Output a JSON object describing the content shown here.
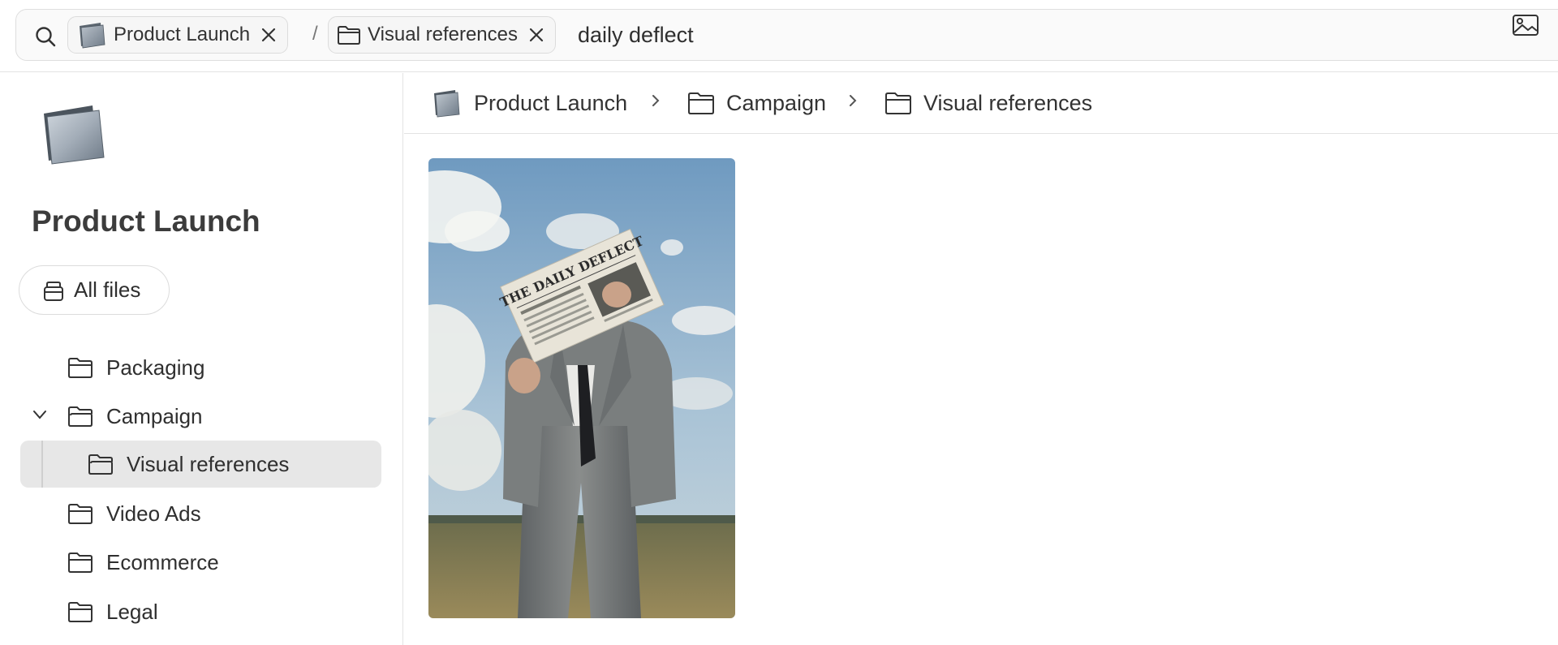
{
  "search": {
    "chips": [
      {
        "label": "Product Launch",
        "icon": "stack-folder-icon"
      },
      {
        "label": "Visual references",
        "icon": "folder-icon"
      }
    ],
    "separator": "/",
    "query": "daily deflect"
  },
  "sidebar": {
    "title": "Product Launch",
    "all_files_label": "All files",
    "items": [
      {
        "label": "Packaging",
        "icon": "folder-icon"
      },
      {
        "label": "Campaign",
        "icon": "folder-open-icon",
        "expanded": true
      },
      {
        "label": "Visual references",
        "icon": "folder-open-icon",
        "selected": true
      },
      {
        "label": "Video Ads",
        "icon": "folder-icon"
      },
      {
        "label": "Ecommerce",
        "icon": "folder-icon"
      },
      {
        "label": "Legal",
        "icon": "folder-icon"
      }
    ]
  },
  "breadcrumb": [
    {
      "label": "Product Launch",
      "icon": "stack-folder-icon"
    },
    {
      "label": "Campaign",
      "icon": "folder-icon"
    },
    {
      "label": "Visual references",
      "icon": "folder-icon"
    }
  ],
  "results": [
    {
      "image": "person-in-grey-suit-holding-newspaper-in-field",
      "newspaper_masthead": "THE DAILY DEFLECT"
    }
  ],
  "colors": {
    "selected_bg": "#e7e7e7",
    "border": "#e3e3e3",
    "text": "#2f2f2f"
  }
}
